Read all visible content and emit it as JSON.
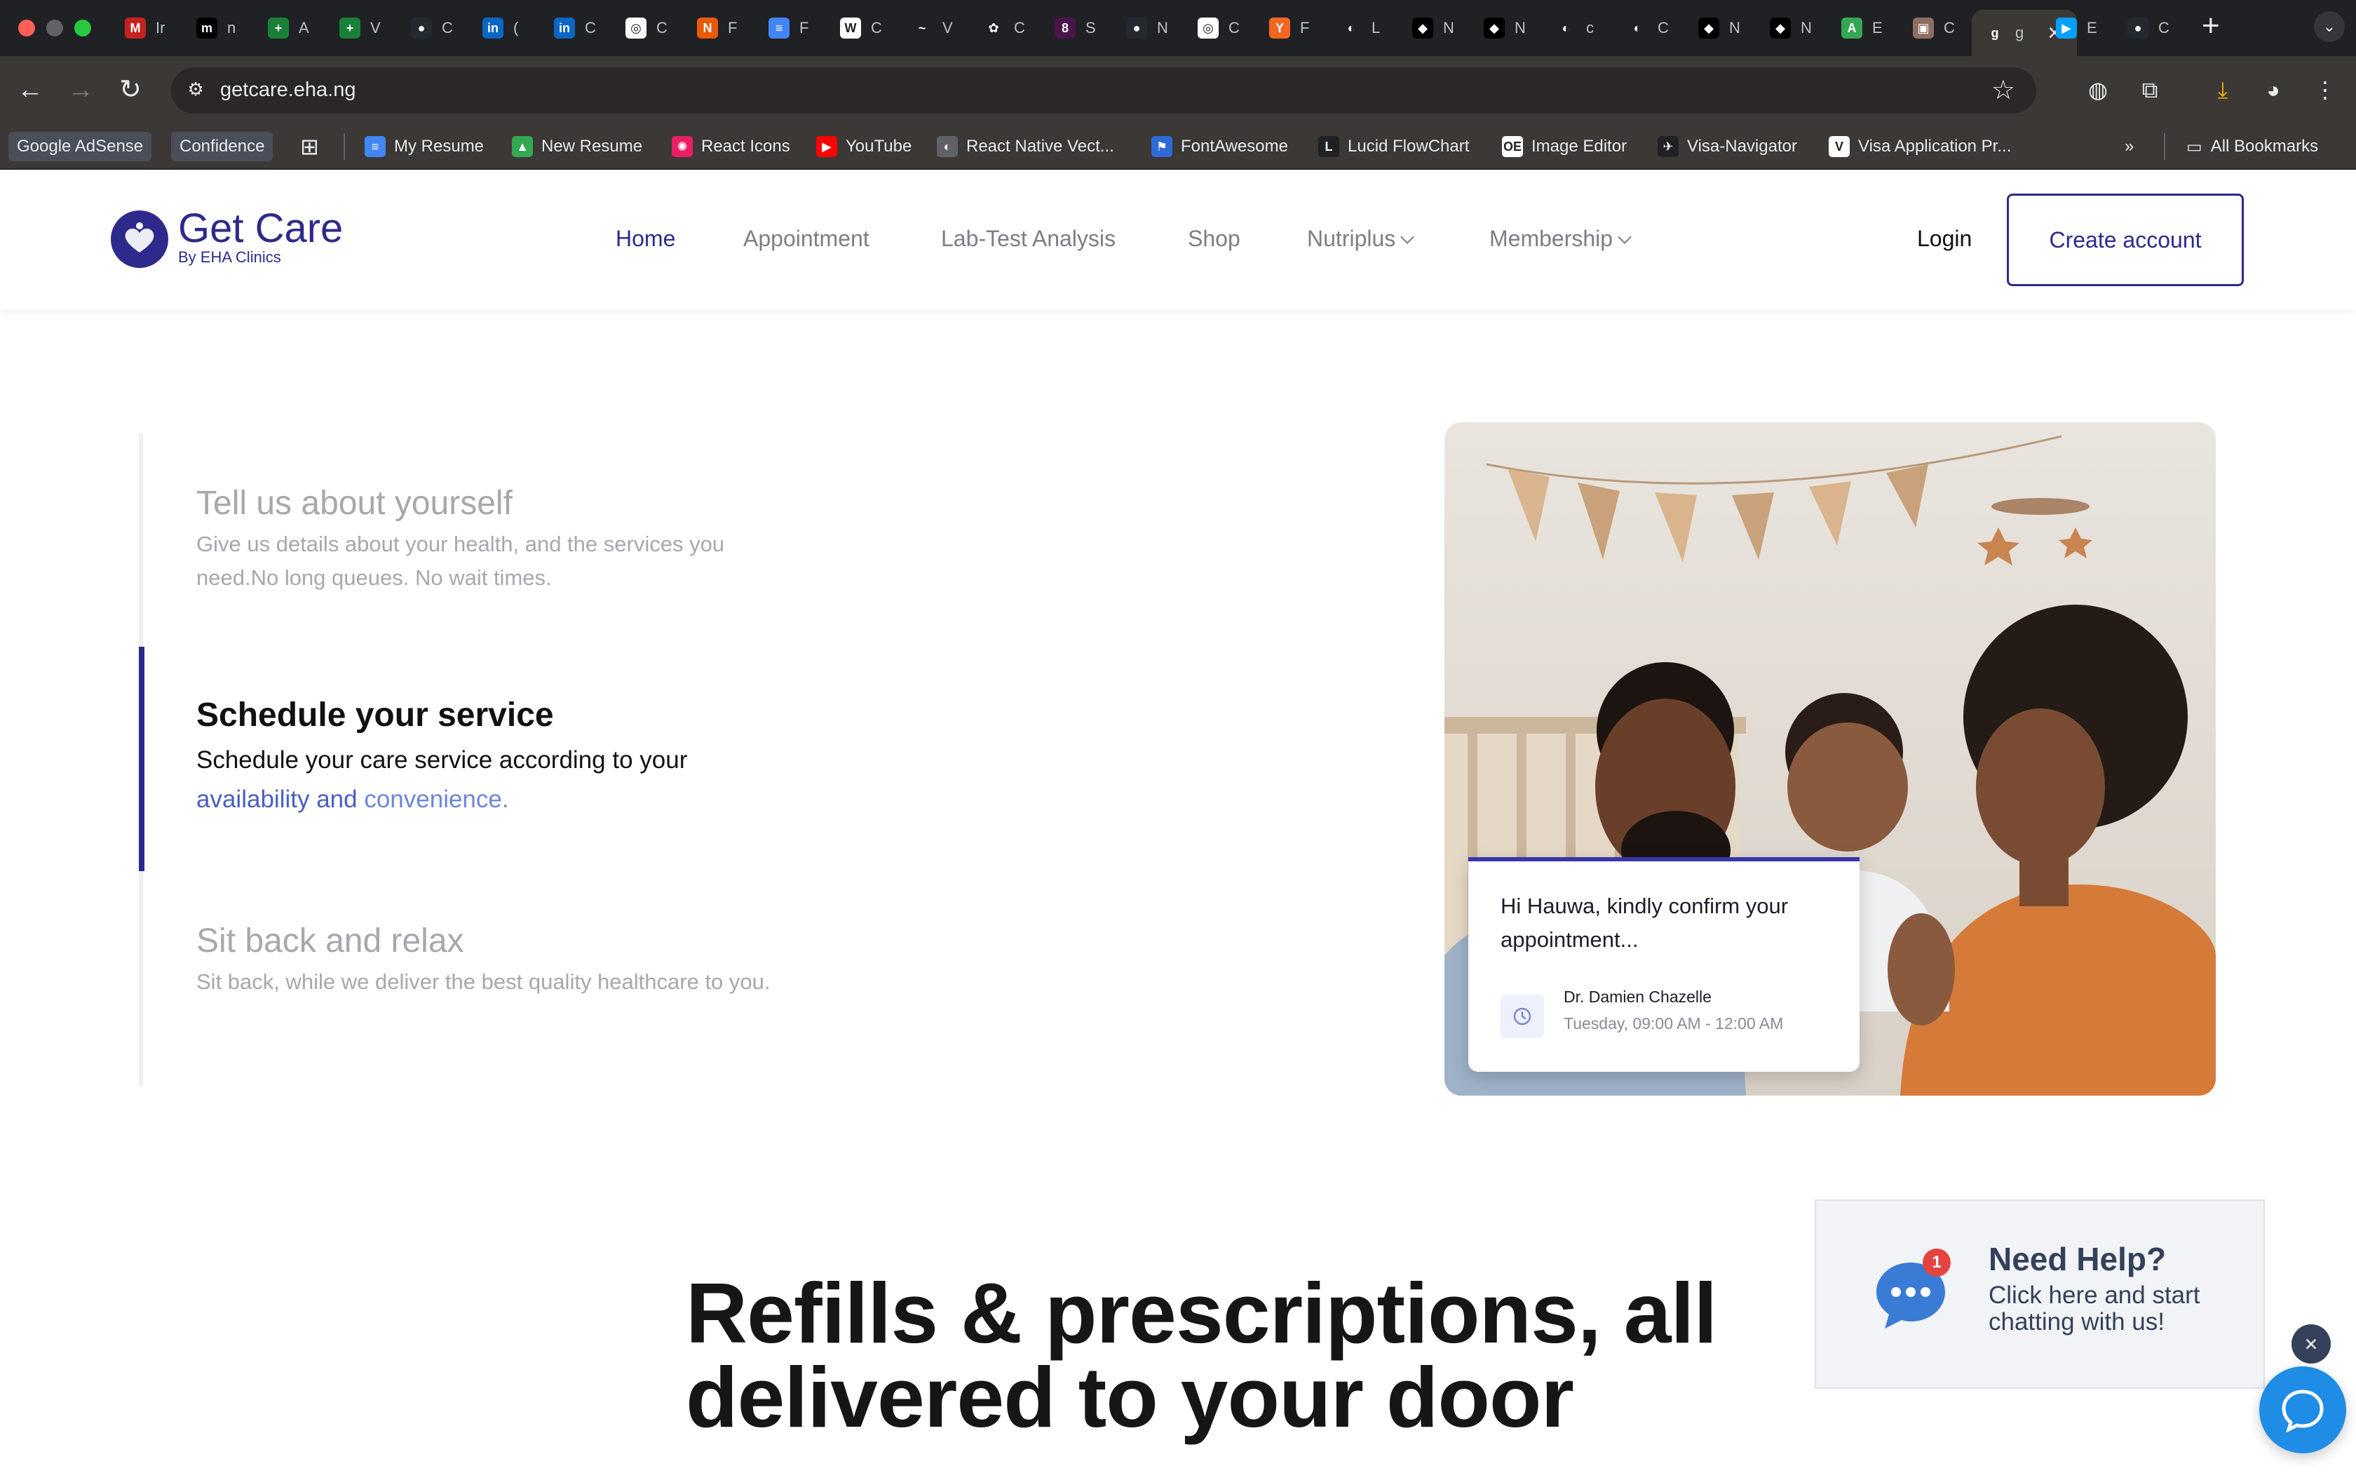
{
  "browser": {
    "tabs": [
      {
        "icon": "gmail-icon",
        "glyph": "M",
        "color": "#c5221f",
        "label": "Ir"
      },
      {
        "icon": "medium-icon",
        "glyph": "m",
        "color": "#000000",
        "label": "n"
      },
      {
        "icon": "sheets-icon",
        "glyph": "+",
        "color": "#188038",
        "label": "A"
      },
      {
        "icon": "sheets-icon",
        "glyph": "+",
        "color": "#188038",
        "label": "V"
      },
      {
        "icon": "github-icon",
        "glyph": "●",
        "color": "#24292f",
        "label": "C"
      },
      {
        "icon": "linkedin-icon",
        "glyph": "in",
        "color": "#0a66c2",
        "label": "("
      },
      {
        "icon": "linkedin-icon",
        "glyph": "in",
        "color": "#0a66c2",
        "label": "C"
      },
      {
        "icon": "chatgpt-icon",
        "glyph": "◎",
        "color": "#ffffff",
        "label": "C"
      },
      {
        "icon": "app-icon",
        "glyph": "N",
        "color": "#e8590c",
        "label": "F"
      },
      {
        "icon": "docs-icon",
        "glyph": "≡",
        "color": "#4285f4",
        "label": "F"
      },
      {
        "icon": "wix-icon",
        "glyph": "W",
        "color": "#ffffff",
        "label": "C"
      },
      {
        "icon": "vercel-icon",
        "glyph": "~",
        "color": "#202124",
        "label": "V"
      },
      {
        "icon": "app-icon",
        "glyph": "✿",
        "color": "#202124",
        "label": "C"
      },
      {
        "icon": "slack-icon",
        "glyph": "8",
        "color": "#4a154b",
        "label": "S"
      },
      {
        "icon": "github-icon",
        "glyph": "●",
        "color": "#24292f",
        "label": "N"
      },
      {
        "icon": "chatgpt-icon",
        "glyph": "◎",
        "color": "#ffffff",
        "label": "C"
      },
      {
        "icon": "ycombinator-icon",
        "glyph": "Y",
        "color": "#f26522",
        "label": "F"
      },
      {
        "icon": "globe-icon",
        "glyph": "◐",
        "color": "#202124",
        "label": "L"
      },
      {
        "icon": "app-icon",
        "glyph": "◆",
        "color": "#000000",
        "label": "N"
      },
      {
        "icon": "app-icon",
        "glyph": "◆",
        "color": "#000000",
        "label": "N"
      },
      {
        "icon": "globe-icon",
        "glyph": "◐",
        "color": "#202124",
        "label": "c"
      },
      {
        "icon": "globe-icon",
        "glyph": "◐",
        "color": "#202124",
        "label": "C"
      },
      {
        "icon": "app-icon",
        "glyph": "◆",
        "color": "#000000",
        "label": "N"
      },
      {
        "icon": "app-icon",
        "glyph": "◆",
        "color": "#000000",
        "label": "N"
      },
      {
        "icon": "app-icon",
        "glyph": "A",
        "color": "#34a853",
        "label": "E"
      },
      {
        "icon": "photo-icon",
        "glyph": "▣",
        "color": "#8d6e63",
        "label": "C"
      },
      {
        "icon": "getcare-icon",
        "glyph": "g",
        "color": "#3c3836",
        "label": "g"
      },
      {
        "icon": "play-icon",
        "glyph": "▶",
        "color": "#00a0ff",
        "label": "E"
      },
      {
        "icon": "github-icon",
        "glyph": "●",
        "color": "#24292f",
        "label": "C"
      }
    ],
    "url": "getcare.eha.ng",
    "bookmarks": [
      {
        "label": "Google AdSense",
        "pill": true
      },
      {
        "label": "Confidence",
        "pill": true
      },
      {
        "label": "My Resume",
        "icon": "docs-icon",
        "glyph": "≡",
        "color": "#4285f4"
      },
      {
        "label": "New Resume",
        "icon": "drive-icon",
        "glyph": "▲",
        "color": "#34a853"
      },
      {
        "label": "React Icons",
        "icon": "react-icon",
        "glyph": "✺",
        "color": "#e91e63"
      },
      {
        "label": "YouTube",
        "icon": "youtube-icon",
        "glyph": "▶",
        "color": "#ff0000"
      },
      {
        "label": "React Native Vect...",
        "icon": "globe-icon",
        "glyph": "◐",
        "color": "#5f6368"
      },
      {
        "label": "FontAwesome",
        "icon": "flag-icon",
        "glyph": "⚑",
        "color": "#2e6bd6"
      },
      {
        "label": "Lucid FlowChart",
        "icon": "lucid-icon",
        "glyph": "L",
        "color": "#202124"
      },
      {
        "label": "Image Editor",
        "icon": "image-editor-icon",
        "glyph": "OE",
        "color": "#ffffff"
      },
      {
        "label": "Visa-Navigator",
        "icon": "visa-icon",
        "glyph": "✈",
        "color": "#202124"
      },
      {
        "label": "Visa Application Pr...",
        "icon": "visa-app-icon",
        "glyph": "V",
        "color": "#ffffff"
      }
    ],
    "all_bookmarks": "All Bookmarks"
  },
  "site": {
    "logo": {
      "name": "Get Care",
      "sub": "By EHA Clinics"
    },
    "nav": [
      {
        "label": "Home",
        "active": true
      },
      {
        "label": "Appointment"
      },
      {
        "label": "Lab-Test Analysis"
      },
      {
        "label": "Shop"
      },
      {
        "label": "Nutriplus",
        "dropdown": true
      },
      {
        "label": "Membership",
        "dropdown": true
      }
    ],
    "login": "Login",
    "create_account": "Create account"
  },
  "steps": [
    {
      "title": "Tell us about yourself",
      "desc": "Give us details about your health, and the services you need.No long queues. No wait times."
    },
    {
      "title": "Schedule your service",
      "desc_a": "Schedule your care service according to your",
      "desc_b": "availability and",
      "desc_c": "convenience."
    },
    {
      "title": "Sit back and relax",
      "desc": "Sit back, while we deliver the best quality healthcare to you."
    }
  ],
  "appointment_card": {
    "message": "Hi Hauwa, kindly confirm your appointment...",
    "doctor": "Dr. Damien Chazelle",
    "time": "Tuesday, 09:00 AM - 12:00 AM"
  },
  "headline": {
    "line1": "Refills & prescriptions, all",
    "line2": "delivered to your door"
  },
  "help_widget": {
    "title": "Need Help?",
    "text": "Click here and start chatting with us!",
    "badge": "1"
  },
  "colors": {
    "brand": "#2e2a8c",
    "accent": "#3a36a8",
    "chat": "#1f8ce6"
  }
}
